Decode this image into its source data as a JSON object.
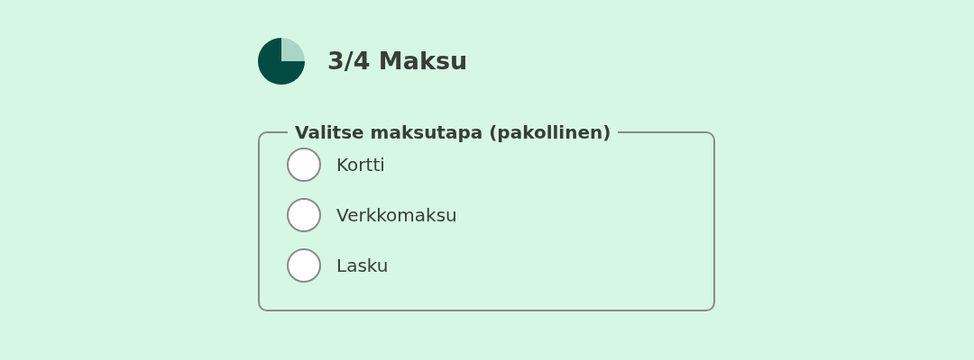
{
  "heading": "3/4 Maksu",
  "fieldset": {
    "legend": "Valitse maksutapa (pakollinen)",
    "options": [
      {
        "label": "Kortti",
        "selected": false
      },
      {
        "label": "Verkkomaksu",
        "selected": false
      },
      {
        "label": "Lasku",
        "selected": false
      }
    ]
  }
}
